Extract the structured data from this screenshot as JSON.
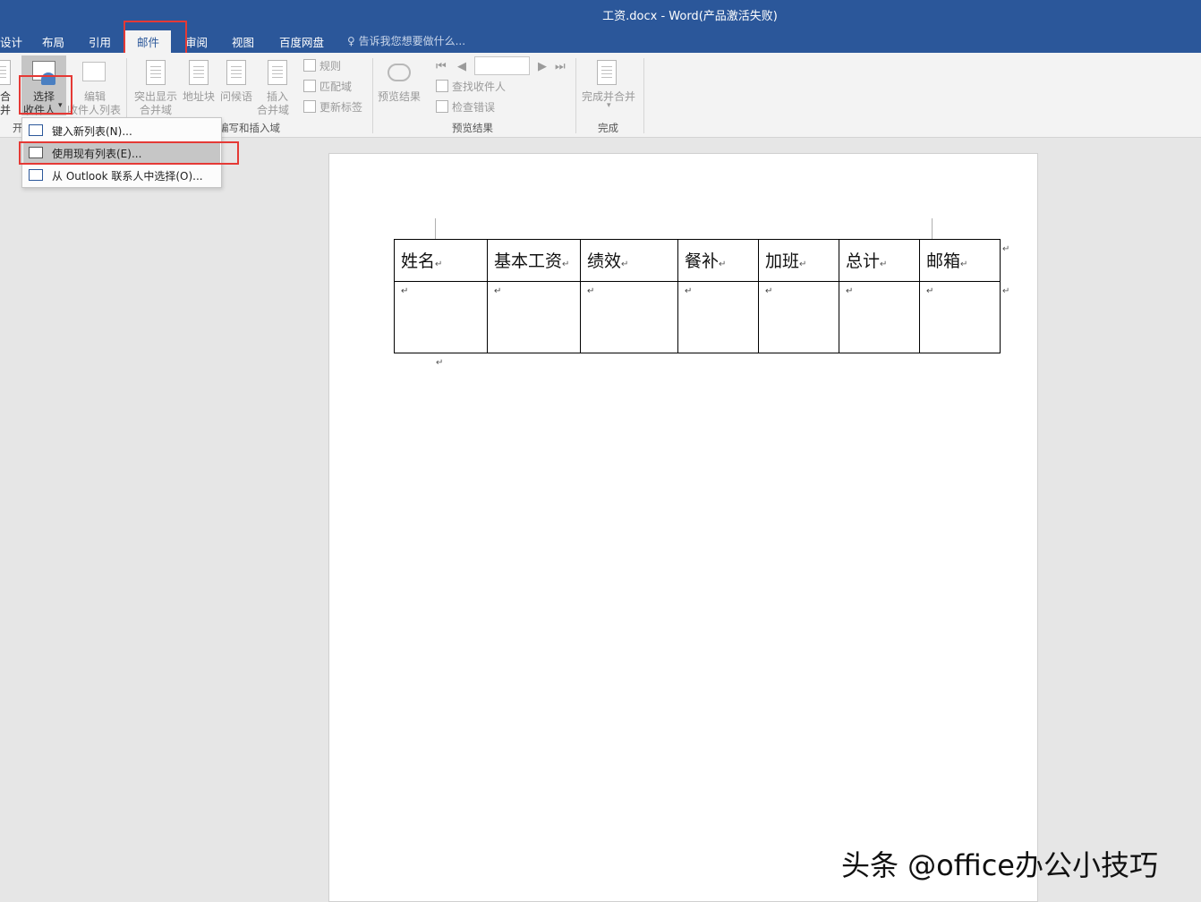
{
  "window": {
    "title": "工资.docx - Word(产品激活失败)"
  },
  "tabs": [
    {
      "id": "design",
      "label": "设计"
    },
    {
      "id": "layout",
      "label": "布局"
    },
    {
      "id": "references",
      "label": "引用"
    },
    {
      "id": "mailings",
      "label": "邮件",
      "active": true
    },
    {
      "id": "review",
      "label": "审阅"
    },
    {
      "id": "view",
      "label": "视图"
    },
    {
      "id": "baidu",
      "label": "百度网盘"
    }
  ],
  "tell_me": "告诉我您想要做什么...",
  "ribbon": {
    "start": {
      "merge_top": "合",
      "merge_bottom": "并",
      "group_label": "开"
    },
    "select_recipients": {
      "line1": "选择",
      "line2": "收件人"
    },
    "edit_recipients": {
      "line1": "编辑",
      "line2": "收件人列表"
    },
    "highlight": {
      "line1": "突出显示",
      "line2": "合并域"
    },
    "address_block": "地址块",
    "greeting": "问候语",
    "insert_field": {
      "line1": "插入",
      "line2": "合并域"
    },
    "rules": "规则",
    "match_fields": "匹配域",
    "update_labels": "更新标签",
    "write_insert_group": "编写和插入域",
    "preview_results": "预览结果",
    "find_recipient": "查找收件人",
    "check_errors": "检查错误",
    "preview_group": "预览结果",
    "finish_merge": "完成并合并",
    "finish_group": "完成"
  },
  "dropdown": [
    {
      "label": "键入新列表(N)..."
    },
    {
      "label": "使用现有列表(E)...",
      "highlighted": true
    },
    {
      "label": "从 Outlook 联系人中选择(O)..."
    }
  ],
  "document": {
    "headers": [
      "姓名",
      "基本工资",
      "绩效",
      "餐补",
      "加班",
      "总计",
      "邮箱"
    ],
    "paragraph_mark": "↵"
  },
  "watermark": "头条 @office办公小技巧"
}
